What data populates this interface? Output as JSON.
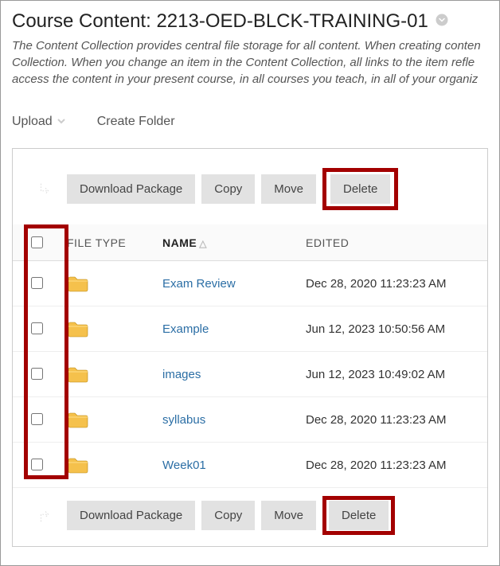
{
  "header": {
    "title_prefix": "Course Content: ",
    "title_id": "2213-OED-BLCK-TRAINING-01",
    "description": "The Content Collection provides central file storage for all content. When creating conten\nCollection. When you change an item in the Content Collection, all links to the item refle\naccess the content in your present course, in all courses you teach, in all of your organiz"
  },
  "toolbar": {
    "upload_label": "Upload",
    "create_folder_label": "Create Folder"
  },
  "actions": {
    "download_label": "Download Package",
    "copy_label": "Copy",
    "move_label": "Move",
    "delete_label": "Delete"
  },
  "columns": {
    "filetype": "FILE TYPE",
    "name": "NAME",
    "edited": "EDITED"
  },
  "rows": [
    {
      "name": "Exam Review",
      "edited": "Dec 28, 2020 11:23:23 AM"
    },
    {
      "name": "Example",
      "edited": "Jun 12, 2023 10:50:56 AM"
    },
    {
      "name": "images",
      "edited": "Jun 12, 2023 10:49:02 AM"
    },
    {
      "name": "syllabus",
      "edited": "Dec 28, 2020 11:23:23 AM"
    },
    {
      "name": "Week01",
      "edited": "Dec 28, 2020 11:23:23 AM"
    }
  ]
}
